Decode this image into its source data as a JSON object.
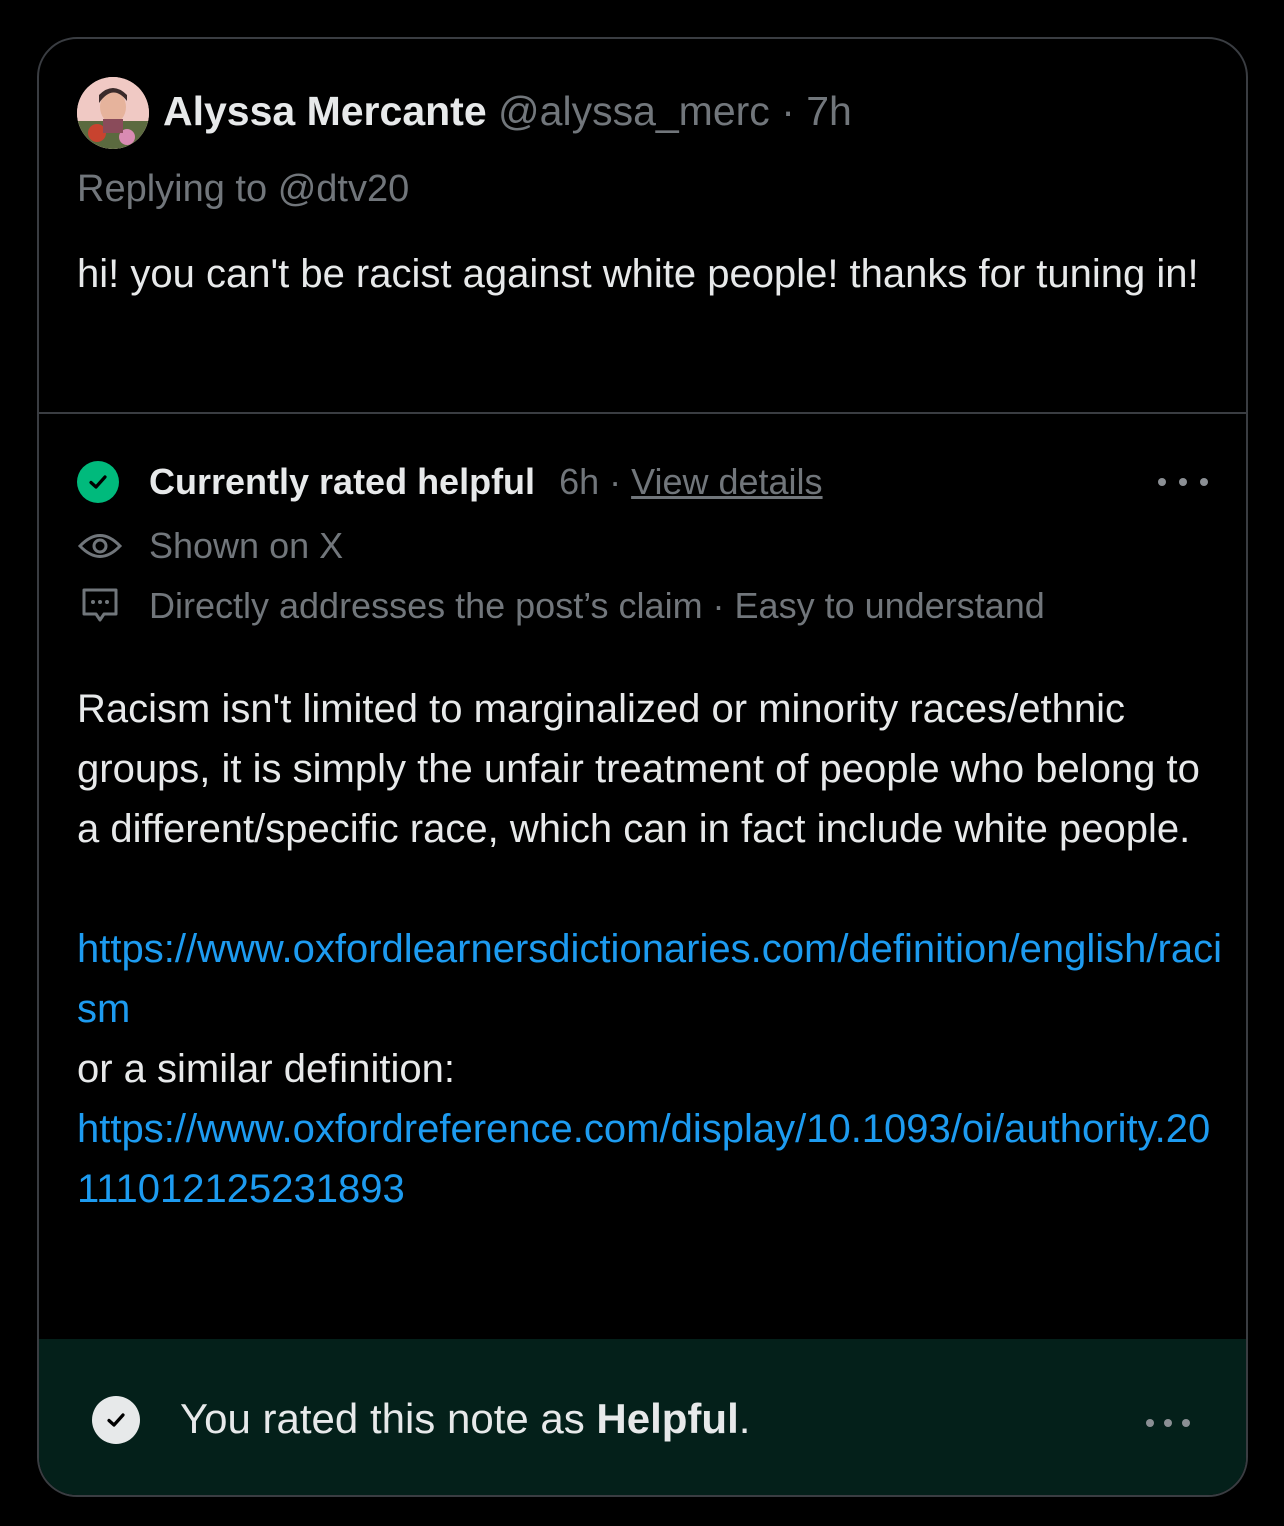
{
  "post": {
    "author_name": "Alyssa Mercante",
    "author_handle": "@alyssa_merc",
    "separator": "·",
    "time": "7h",
    "replying_prefix": "Replying to",
    "replying_handle": "@dtv20",
    "text": "hi! you can't be racist against white people! thanks for tuning in!"
  },
  "note": {
    "status": "Currently rated helpful",
    "time": "6h",
    "separator": "·",
    "view_details": "View details",
    "shown_on": "Shown on X",
    "tags": "Directly addresses the post’s claim · Easy to understand",
    "body": "Racism isn't limited to marginalized or minority races/ethnic groups, it is simply the unfair treatment of people who belong to a different/specific race, which can in fact include white people.",
    "link1": "https://www.oxfordlearnersdictionaries.com/definition/english/racism",
    "connector": "or a similar definition:",
    "link2": "https://www.oxfordreference.com/display/10.1093/oi/authority.20111012125231893"
  },
  "footer": {
    "prefix": "You rated this note as ",
    "rating": "Helpful",
    "suffix": "."
  },
  "colors": {
    "background": "#000000",
    "text_primary": "#e7e9ea",
    "text_secondary": "#71767b",
    "link": "#1d9bf0",
    "helpful_green": "#00ba7c",
    "footer_bg": "#04201a"
  },
  "icons": {
    "status": "check-circle-icon",
    "shown": "eye-icon",
    "tags": "message-bubble-icon",
    "more": "more-horizontal-icon",
    "footer": "check-circle-icon"
  }
}
